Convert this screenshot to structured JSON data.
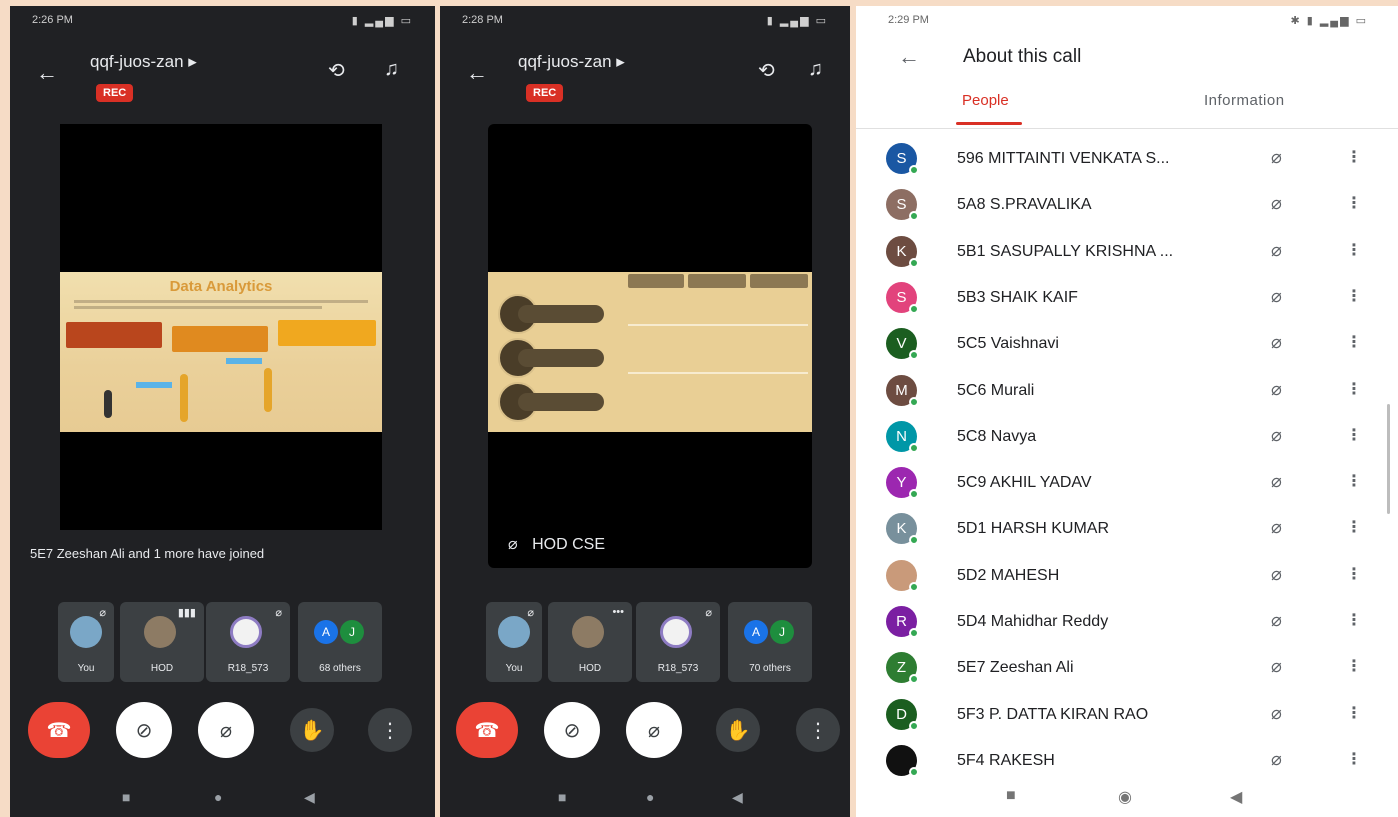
{
  "phone1": {
    "time": "2:26 PM",
    "meeting_code": "qqf-juos-zan ▸",
    "rec_label": "REC",
    "slide_title": "Data Analytics",
    "notification": "5E7 Zeeshan Ali and 1 more have joined",
    "tiles": [
      {
        "name": "You"
      },
      {
        "name": "HOD"
      },
      {
        "name": "R18_573"
      },
      {
        "name": "68 others",
        "letters": [
          "A",
          "J"
        ]
      }
    ]
  },
  "phone2": {
    "time": "2:28 PM",
    "meeting_code": "qqf-juos-zan ▸",
    "rec_label": "REC",
    "presenter": "HOD CSE",
    "tiles": [
      {
        "name": "You"
      },
      {
        "name": "HOD"
      },
      {
        "name": "R18_573"
      },
      {
        "name": "70 others",
        "letters": [
          "A",
          "J"
        ]
      }
    ]
  },
  "about": {
    "time": "2:29 PM",
    "title": "About this call",
    "tabs": {
      "people": "People",
      "information": "Information"
    },
    "participants": [
      {
        "initial": "S",
        "name": "596 MITTAINTI VENKATA S...",
        "color": "#1a57a3"
      },
      {
        "initial": "S",
        "name": "5A8 S.PRAVALIKA",
        "color": "#8d6e63"
      },
      {
        "initial": "K",
        "name": "5B1 SASUPALLY KRISHNA ...",
        "color": "#6d4c41"
      },
      {
        "initial": "S",
        "name": "5B3 SHAIK KAIF",
        "color": "#e2437c"
      },
      {
        "initial": "V",
        "name": "5C5 Vaishnavi",
        "color": "#1b5e20"
      },
      {
        "initial": "M",
        "name": "5C6 Murali",
        "color": "#6d4c41"
      },
      {
        "initial": "N",
        "name": "5C8 Navya",
        "color": "#0097a7"
      },
      {
        "initial": "Y",
        "name": "5C9 AKHIL YADAV",
        "color": "#9c27b0"
      },
      {
        "initial": "K",
        "name": "5D1 HARSH KUMAR",
        "color": "#78909c"
      },
      {
        "initial": "",
        "name": "5D2 MAHESH",
        "color": "#c99a7a"
      },
      {
        "initial": "R",
        "name": "5D4 Mahidhar Reddy",
        "color": "#7b1fa2"
      },
      {
        "initial": "Z",
        "name": "5E7 Zeeshan Ali",
        "color": "#2e7d32"
      },
      {
        "initial": "D",
        "name": "5F3 P. DATTA KIRAN RAO",
        "color": "#1b5e20"
      },
      {
        "initial": "",
        "name": "5F4 RAKESH",
        "color": "#111111"
      }
    ]
  }
}
